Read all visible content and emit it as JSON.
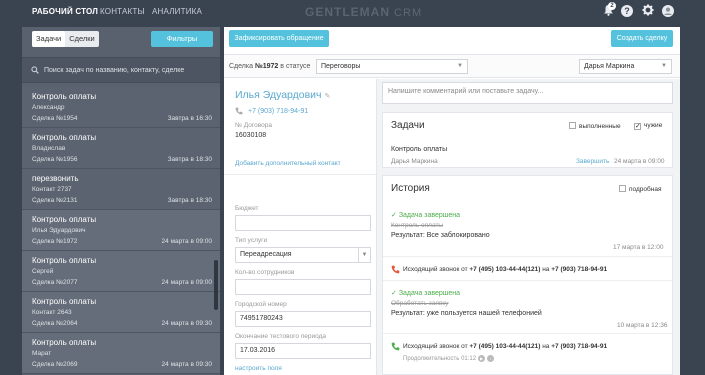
{
  "nav": {
    "items": [
      "РАБОЧИЙ СТОЛ",
      "КОНТАКТЫ",
      "АНАЛИТИКА"
    ],
    "logo_main": "GENTLEMAN",
    "logo_sub": " CRM",
    "notifications_count": "2",
    "help_glyph": "?"
  },
  "left": {
    "tabs": [
      "Задачи",
      "Сделки"
    ],
    "filter_label": "Фильтры",
    "search_placeholder": "Поиск задач по названию, контакту, сделке",
    "tasks": [
      {
        "title": "Контроль оплаты",
        "name": "Александр",
        "deal": "Сделка №1954",
        "date": "Завтра в 16:30"
      },
      {
        "title": "Контроль оплаты",
        "name": "Владислав",
        "deal": "Сделка №1956",
        "date": "Завтра в 18:30"
      },
      {
        "title": "перезвонить",
        "name": "Контакт 2737",
        "deal": "Сделка №2131",
        "date": "Завтра в 18:30"
      },
      {
        "title": "Контроль оплаты",
        "name": "Илья Эдуардович",
        "deal": "Сделка №1972",
        "date": "24 марта в 09:00"
      },
      {
        "title": "Контроль оплаты",
        "name": "Сергей",
        "deal": "Сделка №2077",
        "date": "24 марта в 09:00"
      },
      {
        "title": "Контроль оплаты",
        "name": "Контакт 2643",
        "deal": "Сделка №2064",
        "date": "24 марта в 09:30"
      },
      {
        "title": "Контроль оплаты",
        "name": "Марат",
        "deal": "Сделка №2069",
        "date": "24 марта в 09:30"
      }
    ]
  },
  "toolbar": {
    "fix_label": "Зафиксировать обращение",
    "create_label": "Создать сделку"
  },
  "deal": {
    "prefix": "Сделка",
    "number": "№1972",
    "status_word": "в статусе",
    "status": "Переговоры",
    "owner": "Дарья Маркина"
  },
  "contact": {
    "name": "Илья Эдуардович",
    "phone": "+7 (903) 718-94-91",
    "contract_label": "№ Договора",
    "contract_value": "16030108",
    "add_contact": "Добавить дополнительный контакт",
    "fields": {
      "budget_label": "Бюджет",
      "service_label": "Тип услуги",
      "service_value": "Переадресация",
      "employees_label": "Кол-во сотрудников",
      "city_number_label": "Городской номер",
      "city_number_value": "74951780243",
      "trial_end_label": "Окончание тестового периода",
      "trial_end_value": "17.03.2016"
    },
    "set_fields": "настроить поля"
  },
  "right": {
    "comment_placeholder": "Напишите комментарий или поставьте задачу...",
    "tasks_card": {
      "title": "Задачи",
      "check_done": "выполненные",
      "check_foreign": "чужие",
      "item_title": "Контроль оплаты",
      "item_owner": "Дарья Маркина",
      "item_action": "Завершить",
      "item_date": "24 марта в 09:00"
    },
    "history_card": {
      "title": "История",
      "check_detailed": "подробная",
      "e1_status": "Задача завершена",
      "e1_task": "Контроль оплаты",
      "e1_result": "Результат: Все заблокировано",
      "e1_date": "17 марта в 12:00",
      "call1_prefix": "Исходящий звонок от ",
      "call1_from": "+7 (495) 103-44-44(121)",
      "call1_mid": " на ",
      "call1_to": "+7 (903) 718-94-91",
      "e2_status": "Задача завершена",
      "e2_task": "Обработать заявку",
      "e2_result": "Результат: уже пользуется нашей телефонией",
      "e2_date": "10 марта в 12:36",
      "call2_prefix": "Исходящий звонок от ",
      "call2_from": "+7 (495) 103-44-44(121)",
      "call2_mid": " на ",
      "call2_to": "+7 (903) 718-94-91",
      "duration": "Продолжительность 01:12"
    }
  },
  "colors": {
    "accent": "#54c2dc",
    "link": "#5aa8cf",
    "success": "#4cae4c",
    "incoming_call": "#e05a3a",
    "outgoing_call": "#4cae4c"
  }
}
